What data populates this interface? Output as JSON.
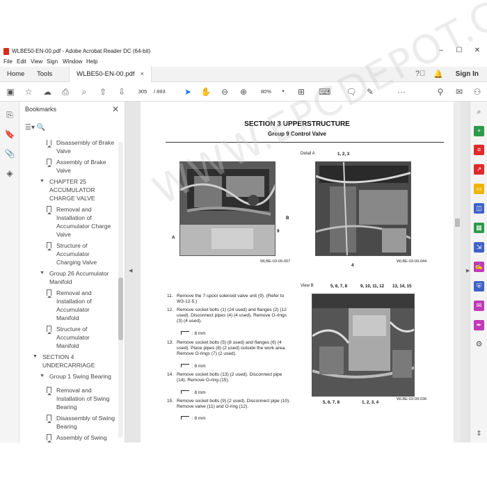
{
  "window": {
    "title": "WLBE50-EN-00.pdf - Adobe Acrobat Reader DC (64-bit)",
    "controls": {
      "minimize": "–",
      "maximize": "☐",
      "close": "✕"
    }
  },
  "menu": [
    "File",
    "Edit",
    "View",
    "Sign",
    "Window",
    "Help"
  ],
  "tabs": {
    "home": "Home",
    "tools": "Tools",
    "doc": "WLBE50-EN-00.pdf",
    "close": "×",
    "signin": "Sign In"
  },
  "toolbar": {
    "page_current": "305",
    "page_total": "/ 893",
    "zoom": "80%"
  },
  "bookmarks": {
    "header": "Bookmarks",
    "close": "✕",
    "items": [
      {
        "label": "Disassembly of Brake",
        "level": 2
      },
      {
        "label": "Valve",
        "level": 2
      },
      {
        "label": "Assembly of Brake",
        "level": 2
      },
      {
        "label": "Valve",
        "level": 2
      },
      {
        "label": "CHAPTER 25",
        "level": 1
      },
      {
        "label": "ACCUMULATOR",
        "level": 1
      },
      {
        "label": "CHARGE VALVE",
        "level": 1
      },
      {
        "label": "Removal and",
        "level": 2
      },
      {
        "label": "Installation of",
        "level": 2
      },
      {
        "label": "Accumulator Charge",
        "level": 2
      },
      {
        "label": "Valve",
        "level": 2
      },
      {
        "label": "Structure of",
        "level": 2
      },
      {
        "label": "Accumulator",
        "level": 2
      },
      {
        "label": "Charging Valve",
        "level": 2
      },
      {
        "label": "Group 26 Accumulator",
        "level": 1
      },
      {
        "label": "Manifold",
        "level": 1
      },
      {
        "label": "Removal and",
        "level": 2
      },
      {
        "label": "Installation of",
        "level": 2
      },
      {
        "label": "Accumulator",
        "level": 2
      },
      {
        "label": "Manifold",
        "level": 2
      },
      {
        "label": "Structure of",
        "level": 2
      },
      {
        "label": "Accumulator",
        "level": 2
      },
      {
        "label": "Manifold",
        "level": 2
      },
      {
        "label": "SECTION 4",
        "level": 0
      },
      {
        "label": "UNDERCARRIAGE",
        "level": 0
      },
      {
        "label": "Group 1 Swing Bearing",
        "level": 1
      },
      {
        "label": "Removal and",
        "level": 2
      },
      {
        "label": "Installation of Swing",
        "level": 2
      },
      {
        "label": "Bearing",
        "level": 2
      },
      {
        "label": "Disassembly of Swing",
        "level": 2
      },
      {
        "label": "Bearing",
        "level": 2
      },
      {
        "label": "Assembly of Swing",
        "level": 2
      }
    ]
  },
  "document": {
    "section": "SECTION 3 UPPERSTRUCTURE",
    "group": "Group 9 Control Valve",
    "fig1_caption": "WLBE-03-09-007",
    "fig2_label": "Detail A",
    "fig2_callout_top": "1, 2, 3",
    "fig2_callout_bottom": "4",
    "fig2_caption": "WLBE-03-09-044",
    "fig1_callout_a": "A",
    "fig1_callout_b": "B",
    "fig1_callout_9": "9",
    "fig3_label": "View B",
    "fig3_callouts_top": [
      "5, 6, 7, 8",
      "9, 10, 11, 12",
      "13, 14, 15"
    ],
    "fig3_callouts_bottom": [
      "5, 6, 7, 8",
      "1, 2, 3, 4"
    ],
    "fig3_caption": "WLBE-03-09-036",
    "steps": [
      {
        "num": "11.",
        "text": "Remove the 7-spool solenoid valve unit (9). (Refer to W3-12-5.)"
      },
      {
        "num": "12.",
        "text": "Remove socket bolts (1) (24 used) and flanges (2) (12 used). Disconnect pipes (4) (4 used). Remove O-rings (3) (4 used).",
        "torque": ": 8 mm"
      },
      {
        "num": "13.",
        "text": "Remove socket bolts (5) (8 used) and flanges (6) (4 used). Place pipes (8) (2 used) outside the work area. Remove O-rings (7) (2 used).",
        "torque": ": 8 mm"
      },
      {
        "num": "14.",
        "text": "Remove socket bolts (13) (2 used). Disconnect pipe (14). Remove O-ring (15).",
        "torque": ": 8 mm"
      },
      {
        "num": "15.",
        "text": "Remove socket bolts (9) (2 used). Disconnect pipe (10). Remove valve (11) and O-ring (12).",
        "torque": ": 8 mm"
      }
    ],
    "watermark": "WWW.EPCDEPOT.COM"
  },
  "colors": {
    "accent": "#1473e6",
    "pdf_red": "#d9291c"
  }
}
